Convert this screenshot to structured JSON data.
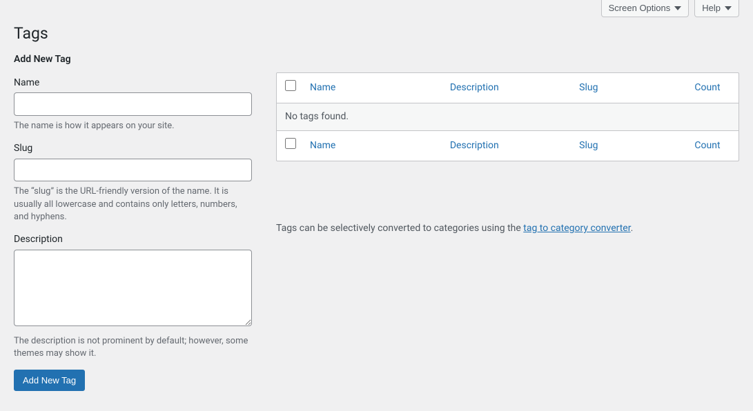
{
  "topbar": {
    "screen_options": "Screen Options",
    "help": "Help"
  },
  "page": {
    "title": "Tags",
    "form_title": "Add New Tag"
  },
  "form": {
    "name": {
      "label": "Name",
      "help": "The name is how it appears on your site."
    },
    "slug": {
      "label": "Slug",
      "help": "The “slug” is the URL-friendly version of the name. It is usually all lowercase and contains only letters, numbers, and hyphens."
    },
    "description": {
      "label": "Description",
      "help": "The description is not prominent by default; however, some themes may show it."
    },
    "submit": "Add New Tag"
  },
  "table": {
    "columns": {
      "name": "Name",
      "description": "Description",
      "slug": "Slug",
      "count": "Count"
    },
    "empty": "No tags found."
  },
  "converter": {
    "prefix": "Tags can be selectively converted to categories using the ",
    "link": "tag to category converter",
    "suffix": "."
  }
}
